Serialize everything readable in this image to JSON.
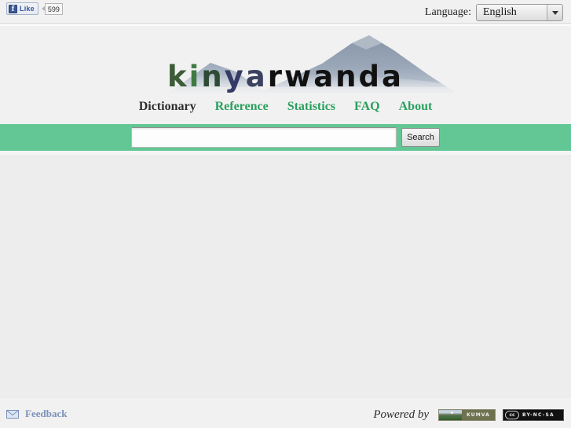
{
  "top_bar": {
    "facebook": {
      "icon": "facebook-f-icon",
      "like_label": "Like",
      "like_count": "599"
    },
    "language": {
      "label": "Language:",
      "selected": "English",
      "options": [
        "English"
      ],
      "arrow_icon": "chevron-down-icon"
    }
  },
  "header": {
    "logo": {
      "text": "kinyarwanda",
      "letters": [
        {
          "char": "k",
          "color": "#3c5c38"
        },
        {
          "char": "i",
          "color": "#3f7a42"
        },
        {
          "char": "n",
          "color": "#2e4a33"
        },
        {
          "char": "y",
          "color": "#353b66"
        },
        {
          "char": "a",
          "color": "#3a4260"
        },
        {
          "char": "r",
          "color": "#111111"
        },
        {
          "char": "w",
          "color": "#111111"
        },
        {
          "char": "a",
          "color": "#111111"
        },
        {
          "char": "n",
          "color": "#111111"
        },
        {
          "char": "d",
          "color": "#111111"
        },
        {
          "char": "a",
          "color": "#111111"
        }
      ],
      "graphic": "mountain-silhouette"
    },
    "nav": [
      {
        "label": "Dictionary",
        "active": true
      },
      {
        "label": "Reference",
        "active": false
      },
      {
        "label": "Statistics",
        "active": false
      },
      {
        "label": "FAQ",
        "active": false
      },
      {
        "label": "About",
        "active": false
      }
    ]
  },
  "search": {
    "value": "",
    "placeholder": "",
    "button_label": "Search",
    "bar_color": "#62c794"
  },
  "content": {
    "body_text": "",
    "background": "#ededed"
  },
  "footer": {
    "feedback": {
      "label": "Feedback",
      "icon": "envelope-icon",
      "color": "#7b92bc"
    },
    "powered_by_label": "Powered by",
    "kumva_badge": {
      "name": "KUMVA",
      "bg_color": "#6f7250"
    },
    "cc_badge": {
      "mark": "cc",
      "terms": "BY-NC-SA"
    }
  },
  "colors": {
    "accent_green": "#62c794",
    "nav_green": "#2aa05e",
    "page_bg": "#efefef",
    "content_bg": "#ededed",
    "chrome_bg": "#f1f1f1"
  }
}
